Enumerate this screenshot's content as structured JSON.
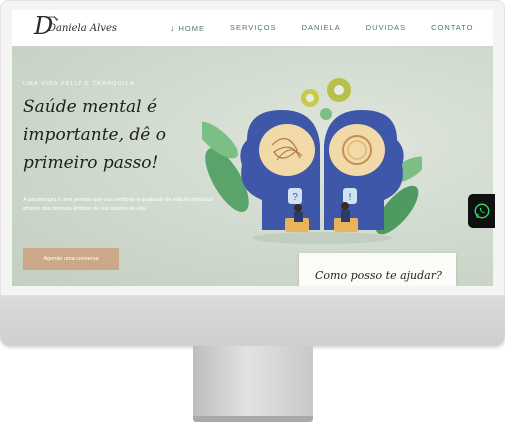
{
  "logo": {
    "text": "Daniela Alves",
    "initial": "D"
  },
  "nav": {
    "items": [
      {
        "label": "HOME",
        "arrow": "↓"
      },
      {
        "label": "SERVIÇOS"
      },
      {
        "label": "DANIELA"
      },
      {
        "label": "DUVIDAS"
      },
      {
        "label": "CONTATO"
      }
    ]
  },
  "hero": {
    "overline": "UMA VIDA FELIZ E TRANQUILA",
    "title": "Saúde mental é importante, dê o primeiro passo!",
    "description": "A psicoterapia é uma jornada que visa melhorar a qualidade de vida do indivíduo através dos diversos âmbitos de sua história de vida.",
    "cta_label": "Agende uma conversa"
  },
  "help_card": {
    "title": "Como posso te ajudar?"
  },
  "icons": {
    "whatsapp": "whatsapp-icon"
  },
  "colors": {
    "accent_green": "#4c7a63",
    "cta": "#caa888",
    "head_blue": "#3f57a8",
    "leaf_green": "#5aa36a",
    "gear": "#c9c94a"
  }
}
